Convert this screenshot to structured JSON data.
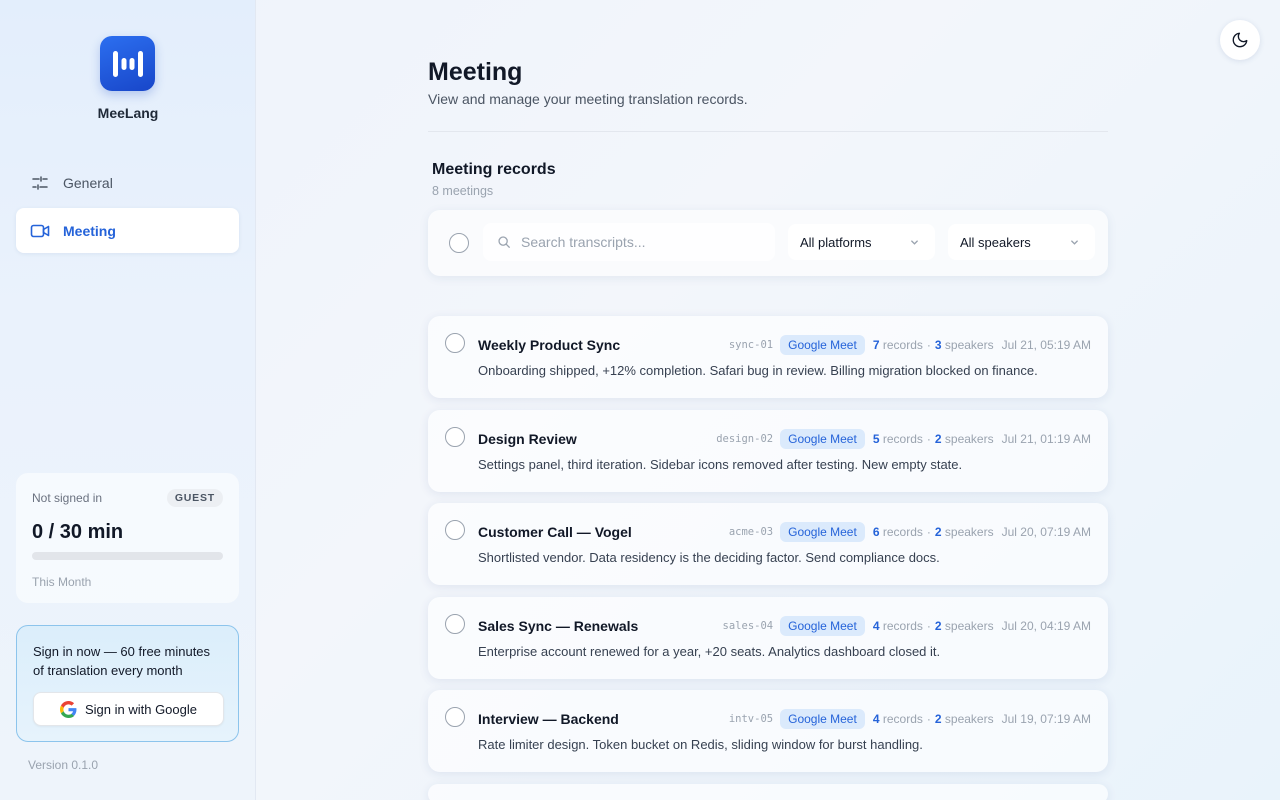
{
  "app": {
    "name": "MeeLang"
  },
  "sidebar": {
    "items": [
      {
        "label": "General",
        "icon": "sliders-icon",
        "active": false
      },
      {
        "label": "Meeting",
        "icon": "video-icon",
        "active": true
      }
    ],
    "usage": {
      "status": "Not signed in",
      "badge": "GUEST",
      "value": "0 / 30 min",
      "progress": 0,
      "period": "This Month"
    },
    "signin": {
      "text": "Sign in now — 60 free minutes of translation every month",
      "button": "Sign in with Google"
    },
    "version": "Version 0.1.0"
  },
  "header": {
    "title": "Meeting",
    "subtitle": "View and manage your meeting translation records."
  },
  "records": {
    "title": "Meeting records",
    "count": "8 meetings",
    "search_placeholder": "Search transcripts...",
    "platform_filter": "All platforms",
    "speaker_filter": "All speakers"
  },
  "meetings": [
    {
      "title": "Weekly Product Sync",
      "code": "sync-01",
      "platform": "Google Meet",
      "records": "7",
      "records_label": "records",
      "speakers": "3",
      "speakers_label": "speakers",
      "date": "Jul 21, 05:19 AM",
      "summary": "Onboarding shipped, +12% completion. Safari bug in review. Billing migration blocked on finance."
    },
    {
      "title": "Design Review",
      "code": "design-02",
      "platform": "Google Meet",
      "records": "5",
      "records_label": "records",
      "speakers": "2",
      "speakers_label": "speakers",
      "date": "Jul 21, 01:19 AM",
      "summary": "Settings panel, third iteration. Sidebar icons removed after testing. New empty state."
    },
    {
      "title": "Customer Call — Vogel",
      "code": "acme-03",
      "platform": "Google Meet",
      "records": "6",
      "records_label": "records",
      "speakers": "2",
      "speakers_label": "speakers",
      "date": "Jul 20, 07:19 AM",
      "summary": "Shortlisted vendor. Data residency is the deciding factor. Send compliance docs."
    },
    {
      "title": "Sales Sync — Renewals",
      "code": "sales-04",
      "platform": "Google Meet",
      "records": "4",
      "records_label": "records",
      "speakers": "2",
      "speakers_label": "speakers",
      "date": "Jul 20, 04:19 AM",
      "summary": "Enterprise account renewed for a year, +20 seats. Analytics dashboard closed it."
    },
    {
      "title": "Interview — Backend",
      "code": "intv-05",
      "platform": "Google Meet",
      "records": "4",
      "records_label": "records",
      "speakers": "2",
      "speakers_label": "speakers",
      "date": "Jul 19, 07:19 AM",
      "summary": "Rate limiter design. Token bucket on Redis, sliding window for burst handling."
    }
  ],
  "colors": {
    "accent": "#2563d9",
    "badge_bg": "#dbeafc",
    "logo": "#1f55d6"
  }
}
